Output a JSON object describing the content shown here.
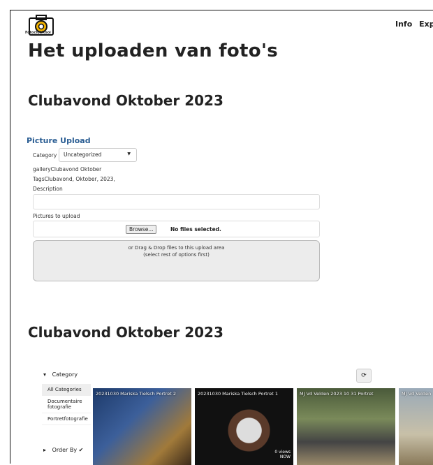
{
  "header": {
    "logo_text": "FotoclubRooi",
    "nav": [
      "Info",
      "Exp"
    ]
  },
  "page_title": "Het uploaden van foto's",
  "section1_title": "Clubavond Oktober 2023",
  "upload": {
    "title": "Picture Upload",
    "category_label": "Category",
    "category_value": "Uncategorized",
    "gallery_line": "galleryClubavond Oktober",
    "tags_line": "TagsClubavond, Oktober, 2023,",
    "description_label": "Description",
    "pictures_label": "Pictures to upload",
    "browse_label": "Browse...",
    "no_files": "No files selected.",
    "drop_line1": "or Drag & Drop files to this upload area",
    "drop_line2": "(select rest of options first)"
  },
  "section2_title": "Clubavond Oktober 2023",
  "gallery": {
    "category_header": "Category",
    "categories": [
      "All Categories",
      "Documentaire fotografie",
      "Portretfotografie"
    ],
    "order_by": "Order By ✔",
    "refresh_icon": "refresh-icon",
    "thumbs": [
      {
        "caption": "20231030 Mariska Tielsch Portret 2",
        "views": ""
      },
      {
        "caption": "20231030 Mariska Tielsch Portret 1",
        "views": "0 views\nNOW"
      },
      {
        "caption": "MJ Vd Velden 2023 10 31 Portret",
        "views": ""
      },
      {
        "caption": "MJ Vd Velden",
        "views": ""
      }
    ]
  }
}
